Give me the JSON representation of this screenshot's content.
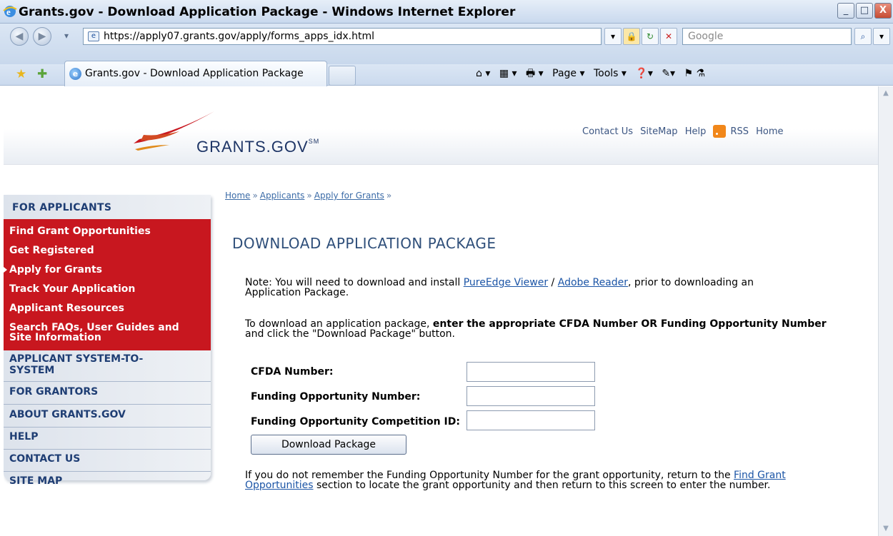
{
  "window": {
    "title": "Grants.gov - Download Application Package - Windows Internet Explorer",
    "minimize_label": "_",
    "maximize_label": "□",
    "close_label": "X"
  },
  "nav": {
    "back_icon": "◀",
    "forward_icon": "▶",
    "dropdown_icon": "▾",
    "address": "https://apply07.grants.gov/apply/forms_apps_idx.html",
    "search_placeholder": "Google",
    "lock_icon": "🔒",
    "refresh_icon": "↻",
    "stop_icon": "✕",
    "search_icon": "⌕"
  },
  "tabs": {
    "active_label": "Grants.gov - Download Application Package"
  },
  "commands": {
    "home": "⌂ ▾",
    "feeds": "▦ ▾",
    "print": "🖶 ▾",
    "page": "Page ▾",
    "tools": "Tools ▾",
    "help": "❓▾",
    "research": "✎▾",
    "extra": "⚑ ⚗"
  },
  "site": {
    "logo_text": "GRANTS.GOV",
    "logo_mark": "SM",
    "top_links": {
      "contact": "Contact Us",
      "sitemap": "SiteMap",
      "help": "Help",
      "rss": "RSS",
      "home": "Home"
    }
  },
  "sidebar": {
    "heading": "FOR APPLICANTS",
    "red_items": [
      {
        "label": "Find Grant Opportunities"
      },
      {
        "label": "Get Registered"
      },
      {
        "label": "Apply for Grants"
      },
      {
        "label": "Track Your Application"
      },
      {
        "label": "Applicant Resources"
      },
      {
        "label": "Search FAQs, User Guides and Site Information"
      }
    ],
    "gray_items": [
      {
        "label": "APPLICANT SYSTEM-TO-SYSTEM"
      },
      {
        "label": "FOR GRANTORS"
      },
      {
        "label": "ABOUT GRANTS.GOV"
      },
      {
        "label": "HELP"
      },
      {
        "label": "CONTACT US"
      },
      {
        "label": "SITE MAP"
      }
    ]
  },
  "breadcrumb": {
    "home": "Home",
    "applicants": "Applicants",
    "apply": "Apply for Grants",
    "sep": "»"
  },
  "page": {
    "title": "DOWNLOAD APPLICATION PACKAGE",
    "note_prefix": "Note: You will need to download and install ",
    "note_link1": "PureEdge Viewer",
    "note_slash": " / ",
    "note_link2": "Adobe Reader",
    "note_suffix": ", prior to downloading an",
    "note_line2": "Application Package.",
    "instr_prefix": "To download an application package, ",
    "instr_bold": "enter the appropriate CFDA Number OR Funding Opportunity Number",
    "instr_line2": "and click the \"Download Package\" button.",
    "labels": {
      "cfda": "CFDA Number:",
      "fon": "Funding Opportunity Number:",
      "comp": "Funding Opportunity Competition ID:"
    },
    "values": {
      "cfda": "",
      "fon": "",
      "comp": ""
    },
    "button": "Download Package",
    "footer_prefix": "If you do not remember the Funding Opportunity Number for the grant opportunity, return to the ",
    "footer_link": "Find Grant Opportunities",
    "footer_link_l1": "Find Grant",
    "footer_link_l2": "Opportunities",
    "footer_suffix": " section to locate the grant opportunity and then return to this screen to enter the number."
  },
  "colors": {
    "red_nav": "#c8171f",
    "brand_navy": "#1e3566",
    "link": "#1c55a6"
  }
}
